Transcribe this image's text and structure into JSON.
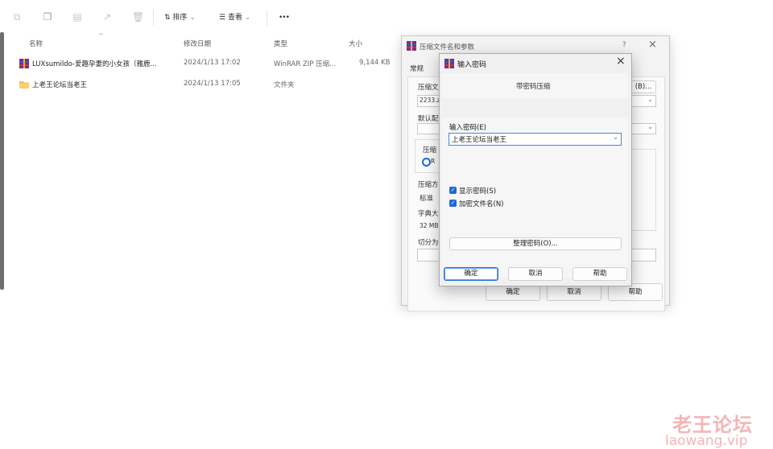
{
  "toolbar": {
    "sort_label": "排序",
    "view_label": "查看",
    "more_label": "•••"
  },
  "columns": {
    "name": "名称",
    "modified": "修改日期",
    "type": "类型",
    "size": "大小"
  },
  "files": [
    {
      "name": "LUXsumildo-爱趣孕妻的小女孩（雅鹿...",
      "modified": "2024/1/13 17:02",
      "type": "WinRAR ZIP 压缩...",
      "size": "9,144 KB"
    },
    {
      "name": "上老王论坛当老王",
      "modified": "2024/1/13 17:05",
      "type": "文件夹",
      "size": ""
    }
  ],
  "back_dialog": {
    "title": "压缩文件名和参数",
    "help_q": "?",
    "tab_general": "常规",
    "archive_name_label": "压缩文",
    "archive_name_value": "2233.z",
    "browse_label": "(B)...",
    "default_profile_label": "默认配",
    "format_label": "压缩",
    "format_radio": "R",
    "method_label": "压缩方",
    "method_value": "标准",
    "dict_label": "字典大",
    "dict_value": "32 MB",
    "split_label": "切分为",
    "ok": "确定",
    "cancel": "取消",
    "help": "帮助"
  },
  "front_dialog": {
    "title": "输入密码",
    "heading": "带密码压缩",
    "password_label": "输入密码(E)",
    "password_value": "上老王论坛当老王",
    "show_password": "显示密码(S)",
    "encrypt_names": "加密文件名(N)",
    "organize": "整理密码(O)...",
    "ok": "确定",
    "cancel": "取消",
    "help": "帮助"
  },
  "watermark": {
    "cn": "老王论坛",
    "url": "laowang.vip"
  },
  "colors": {
    "accent": "#1d6ad6",
    "watermark": "#f2b6b6"
  }
}
